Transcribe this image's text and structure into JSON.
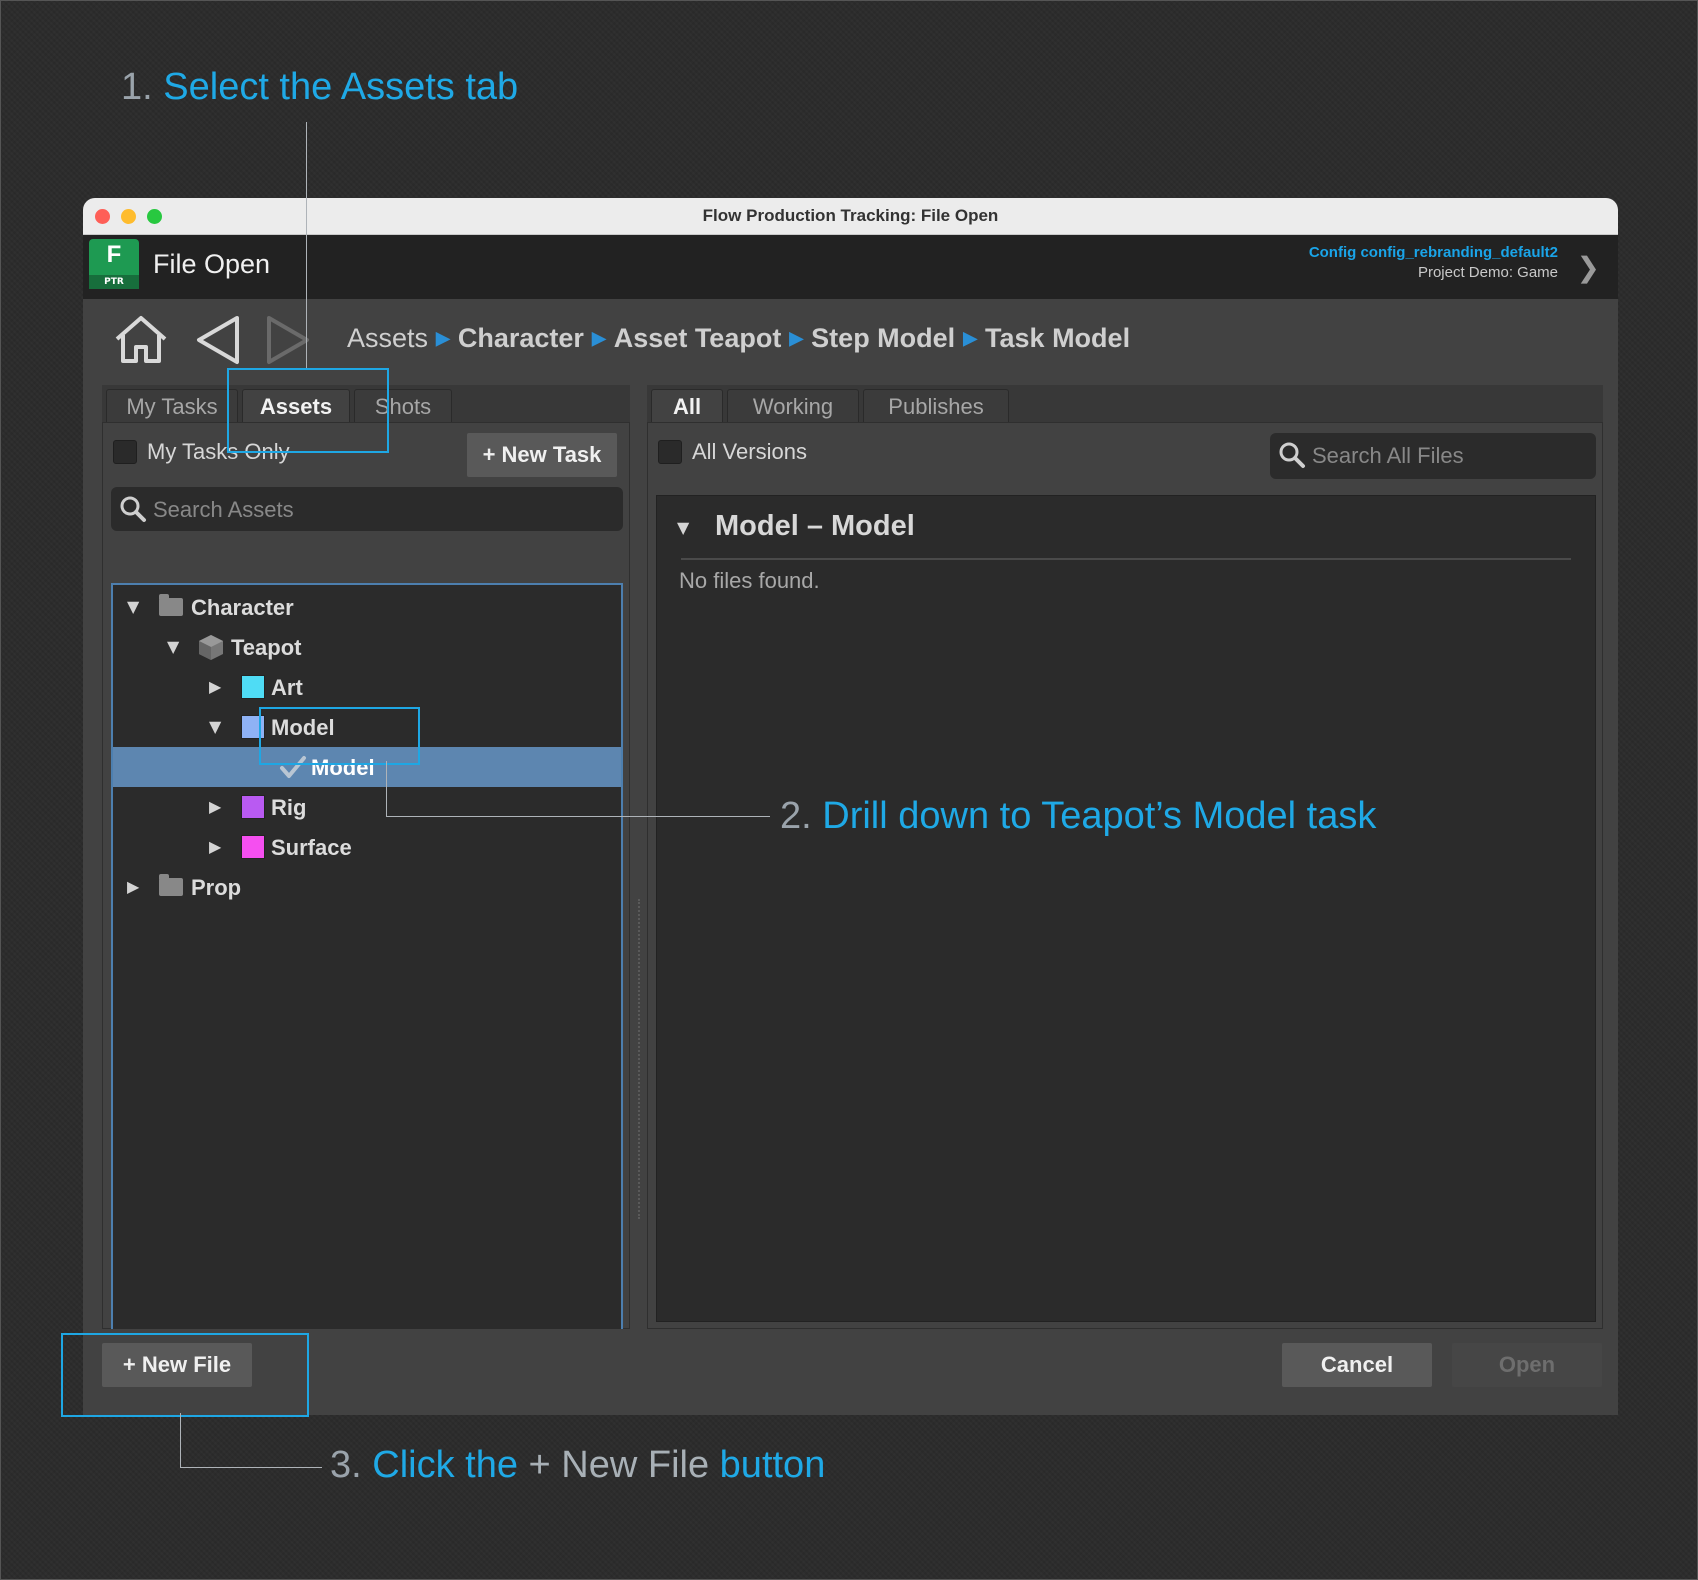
{
  "annotations": {
    "step1": {
      "num": "1.",
      "text": "Select the Assets tab"
    },
    "step2": {
      "num": "2.",
      "text": "Drill down to Teapot’s Model task"
    },
    "step3": {
      "num": "3.",
      "hl1": "Click the",
      "plain": "+ New File",
      "hl2": "button"
    },
    "highlight_color": "#1fa9e6"
  },
  "window": {
    "title": "Flow Production Tracking: File Open",
    "app_title": "File Open",
    "logo": {
      "letter": "F",
      "badge": "PTR"
    },
    "config": "Config config_rebranding_default2",
    "project": "Project Demo: Game"
  },
  "nav": {
    "home_icon": "home-icon",
    "back_icon": "back-arrow-icon",
    "forward_icon": "forward-arrow-icon"
  },
  "breadcrumb": [
    "Assets",
    "Character",
    "Asset Teapot",
    "Step Model",
    "Task Model"
  ],
  "left": {
    "tabs": [
      "My Tasks",
      "Assets",
      "Shots"
    ],
    "active_tab": "Assets",
    "my_tasks_only": "My Tasks Only",
    "new_task": "+ New Task",
    "search_placeholder": "Search Assets",
    "tree": {
      "character": "Character",
      "teapot": "Teapot",
      "art": "Art",
      "model_step": "Model",
      "model_task": "Model",
      "rig": "Rig",
      "surface": "Surface",
      "prop": "Prop"
    },
    "step_colors": {
      "art": "#4fdcf5",
      "model": "#8fb2f5",
      "rig": "#b95af2",
      "surface": "#f54ff0"
    }
  },
  "right": {
    "tabs": [
      "All",
      "Working",
      "Publishes"
    ],
    "active_tab": "All",
    "all_versions": "All Versions",
    "search_placeholder": "Search All Files",
    "group_title": "Model – Model",
    "no_files": "No files found."
  },
  "footer": {
    "new_file": "+ New File",
    "cancel": "Cancel",
    "open": "Open"
  }
}
